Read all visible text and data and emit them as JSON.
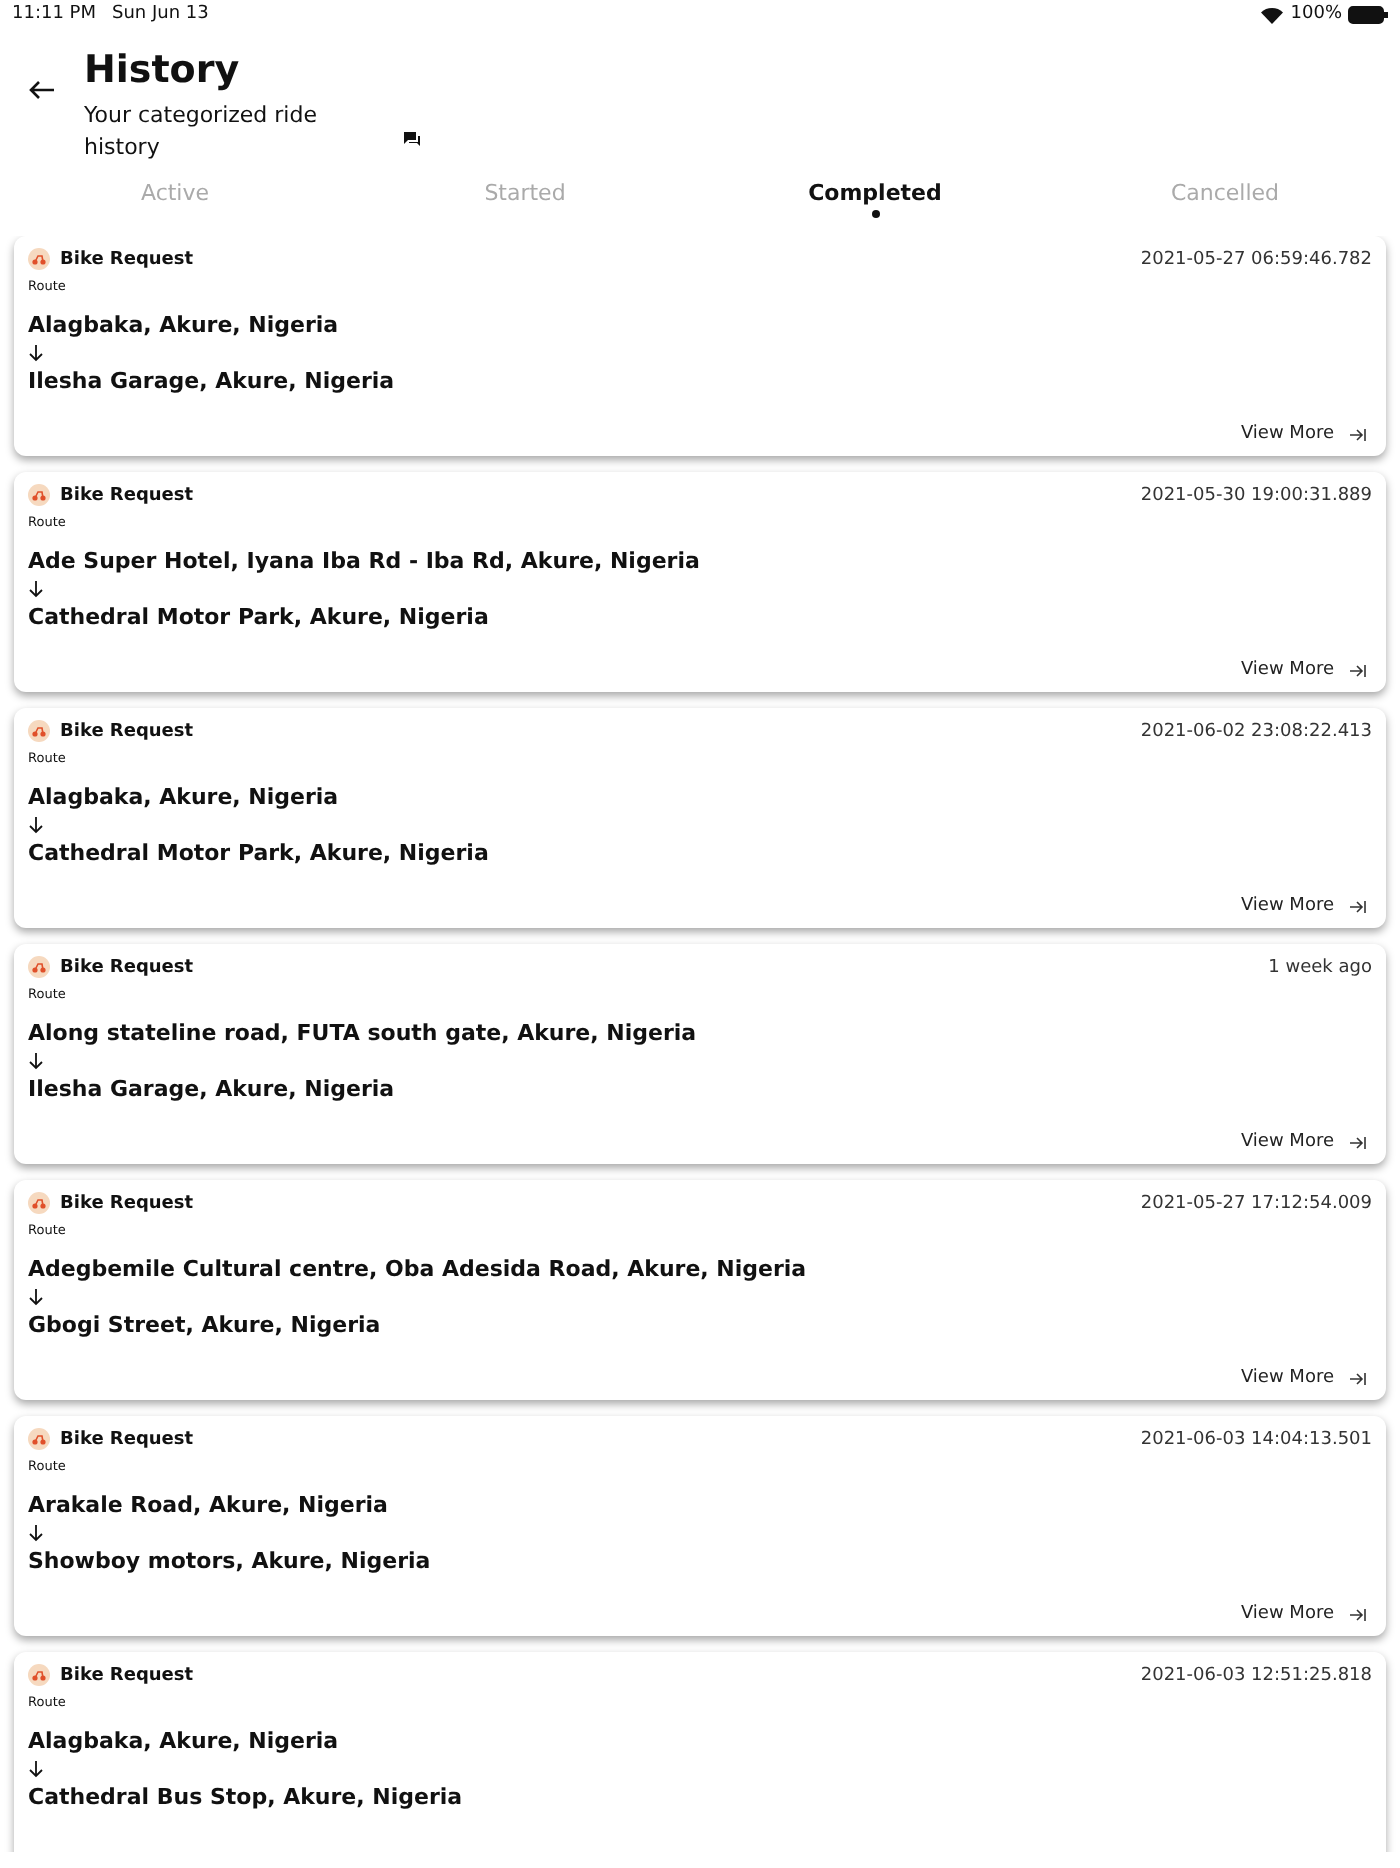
{
  "status_bar": {
    "time": "11:11 PM",
    "date": "Sun Jun 13",
    "battery": "100%"
  },
  "header": {
    "title": "History",
    "subtitle": "Your categorized ride history"
  },
  "tabs": [
    {
      "label": "Active",
      "selected": false
    },
    {
      "label": "Started",
      "selected": false
    },
    {
      "label": "Completed",
      "selected": true
    },
    {
      "label": "Cancelled",
      "selected": false
    }
  ],
  "rides": [
    {
      "type": "Bike Request",
      "time": "2021-05-27 06:59:46.782",
      "route_label": "Route",
      "from": "Alagbaka, Akure, Nigeria",
      "to": "Ilesha Garage, Akure, Nigeria",
      "view_more": "View More"
    },
    {
      "type": "Bike Request",
      "time": "2021-05-30 19:00:31.889",
      "route_label": "Route",
      "from": "Ade Super Hotel, Iyana Iba Rd - Iba Rd, Akure, Nigeria",
      "to": "Cathedral Motor Park, Akure, Nigeria",
      "view_more": "View More"
    },
    {
      "type": "Bike Request",
      "time": "2021-06-02 23:08:22.413",
      "route_label": "Route",
      "from": "Alagbaka, Akure, Nigeria",
      "to": "Cathedral Motor Park, Akure, Nigeria",
      "view_more": "View More"
    },
    {
      "type": "Bike Request",
      "time": "1 week ago",
      "route_label": "Route",
      "from": "Along stateline road, FUTA south gate, Akure, Nigeria",
      "to": "Ilesha Garage, Akure, Nigeria",
      "view_more": "View More"
    },
    {
      "type": "Bike Request",
      "time": "2021-05-27 17:12:54.009",
      "route_label": "Route",
      "from": "Adegbemile Cultural centre, Oba Adesida Road, Akure, Nigeria",
      "to": "Gbogi Street, Akure, Nigeria",
      "view_more": "View More"
    },
    {
      "type": "Bike Request",
      "time": "2021-06-03 14:04:13.501",
      "route_label": "Route",
      "from": "Arakale Road, Akure, Nigeria",
      "to": "Showboy motors, Akure, Nigeria",
      "view_more": "View More"
    },
    {
      "type": "Bike Request",
      "time": "2021-06-03 12:51:25.818",
      "route_label": "Route",
      "from": "Alagbaka, Akure, Nigeria",
      "to": "Cathedral Bus Stop, Akure, Nigeria"
    }
  ]
}
